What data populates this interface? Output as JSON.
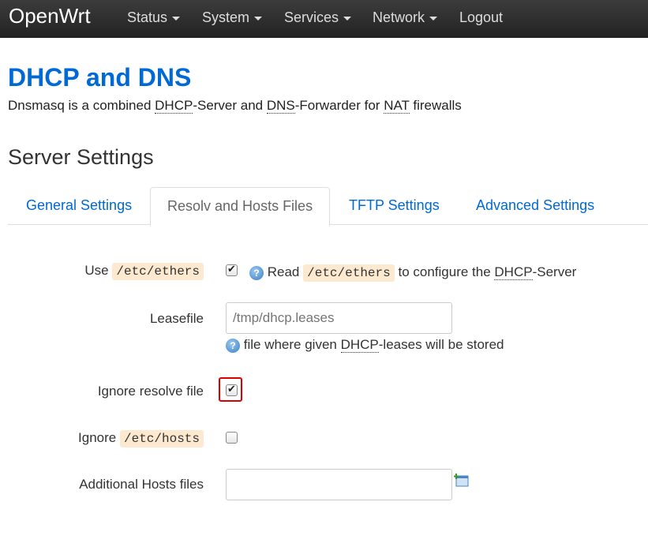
{
  "navbar": {
    "brand": "OpenWrt",
    "items": [
      {
        "label": "Status",
        "dropdown": true
      },
      {
        "label": "System",
        "dropdown": true
      },
      {
        "label": "Services",
        "dropdown": true
      },
      {
        "label": "Network",
        "dropdown": true
      },
      {
        "label": "Logout",
        "dropdown": false
      }
    ]
  },
  "page": {
    "title": "DHCP and DNS",
    "desc_parts": [
      "Dnsmasq is a combined ",
      "DHCP",
      "-Server and ",
      "DNS",
      "-Forwarder for ",
      "NAT",
      " firewalls"
    ]
  },
  "section": {
    "title": "Server Settings"
  },
  "tabs": [
    {
      "label": "General Settings",
      "active": false
    },
    {
      "label": "Resolv and Hosts Files",
      "active": true
    },
    {
      "label": "TFTP Settings",
      "active": false
    },
    {
      "label": "Advanced Settings",
      "active": false
    }
  ],
  "fields": {
    "ethers": {
      "label_prefix": "Use",
      "label_code": "/etc/ethers",
      "checked": true,
      "help_prefix": "Read",
      "help_code": "/etc/ethers",
      "help_mid": "to configure the",
      "help_abbr": "DHCP",
      "help_suffix": "-Server"
    },
    "leasefile": {
      "label": "Leasefile",
      "placeholder": "/tmp/dhcp.leases",
      "help_prefix": "file where given",
      "help_abbr": "DHCP",
      "help_suffix": "-leases will be stored"
    },
    "ignore_resolv": {
      "label": "Ignore resolve file",
      "checked": true
    },
    "ignore_hosts": {
      "label_prefix": "Ignore",
      "label_code": "/etc/hosts",
      "checked": false
    },
    "addn_hosts": {
      "label": "Additional Hosts files",
      "value": ""
    }
  },
  "colors": {
    "link": "#0069d6",
    "highlight": "#dd0000",
    "code_bg": "#fde9cf"
  },
  "icons": {
    "help": "help-icon",
    "add": "add-entry-icon"
  }
}
